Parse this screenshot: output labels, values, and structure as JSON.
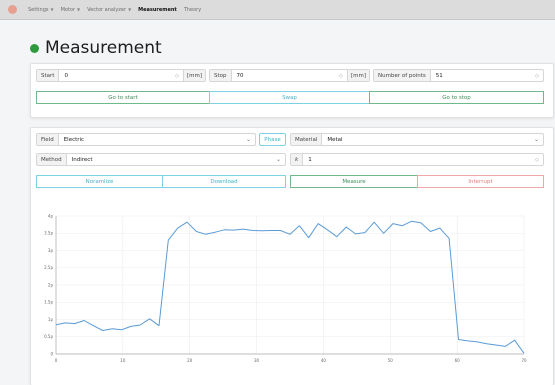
{
  "nav": {
    "items": [
      {
        "label": "Settings",
        "dropdown": true,
        "active": false
      },
      {
        "label": "Motor",
        "dropdown": true,
        "active": false
      },
      {
        "label": "Vector analyzer",
        "dropdown": true,
        "active": false
      },
      {
        "label": "Measurement",
        "dropdown": false,
        "active": true
      },
      {
        "label": "Theory",
        "dropdown": false,
        "active": false
      }
    ]
  },
  "page": {
    "title": "Measurement",
    "status_color": "#2e9a3e"
  },
  "motion": {
    "start_label": "Start",
    "start_value": "0",
    "start_unit": "[mm]",
    "stop_label": "Stop",
    "stop_value": "70",
    "stop_unit": "[mm]",
    "points_label": "Number of points",
    "points_value": "51",
    "go_start": "Go to start",
    "swap": "Swap",
    "go_stop": "Go to stop"
  },
  "config": {
    "field_label": "Field",
    "field_value": "Electric",
    "phase": "Phase",
    "material_label": "Material",
    "material_value": "Metal",
    "method_label": "Method",
    "method_value": "Indirect",
    "k_label": "k",
    "k_value": "1",
    "normalize": "Noramlize",
    "download": "Download",
    "measure": "Measure",
    "interrupt": "Interrupt"
  },
  "colors": {
    "green": "#3a8e58",
    "cyan": "#43b2cb",
    "red": "#e37b7b",
    "line": "#5b9bd5"
  },
  "chart_data": {
    "type": "line",
    "xlim": [
      0,
      70
    ],
    "ylim": [
      0,
      4
    ],
    "x_ticks": [
      0,
      10,
      20,
      30,
      40,
      50,
      60,
      70
    ],
    "y_ticks": [
      0,
      0.5,
      1,
      1.5,
      2,
      2.5,
      3,
      3.5,
      4
    ],
    "y_tick_labels": [
      "0",
      "0.5p",
      "1p",
      "1.5p",
      "2p",
      "2.5p",
      "3p",
      "3.5p",
      "4p"
    ],
    "grid": true,
    "series": [
      {
        "x": [
          0,
          1.4,
          2.8,
          4.2,
          5.6,
          7,
          8.4,
          9.8,
          11.2,
          12.6,
          14,
          15.4,
          16.8,
          18.2,
          19.6,
          21,
          22.4,
          23.8,
          25.2,
          26.6,
          28,
          29.4,
          30.8,
          32.2,
          33.6,
          35,
          36.4,
          37.8,
          39.2,
          40.6,
          42,
          43.4,
          44.8,
          46.2,
          47.6,
          49,
          50.4,
          51.8,
          53.2,
          54.6,
          56,
          57.4,
          58.8,
          60.2,
          61.6,
          63,
          64.4,
          65.8,
          67.2,
          68.6,
          70
        ],
        "y": [
          0.85,
          0.9,
          0.88,
          0.97,
          0.82,
          0.68,
          0.73,
          0.7,
          0.8,
          0.84,
          1.02,
          0.82,
          3.3,
          3.65,
          3.82,
          3.55,
          3.47,
          3.53,
          3.6,
          3.59,
          3.62,
          3.58,
          3.57,
          3.58,
          3.58,
          3.47,
          3.72,
          3.37,
          3.78,
          3.6,
          3.4,
          3.68,
          3.48,
          3.52,
          3.82,
          3.5,
          3.78,
          3.72,
          3.85,
          3.8,
          3.55,
          3.65,
          3.35,
          0.42,
          0.38,
          0.35,
          0.3,
          0.26,
          0.22,
          0.4,
          0.02
        ]
      }
    ]
  }
}
